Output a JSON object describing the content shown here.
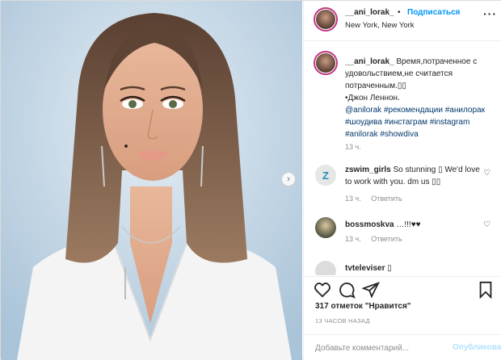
{
  "header": {
    "username": "__ani_lorak_",
    "dot": "•",
    "follow_label": "Подписаться",
    "location": "New York, New York",
    "more_icon": "more-horizontal-icon"
  },
  "caption": {
    "username": "__ani_lorak_",
    "text_line1": "Время,потраченное с удовольствием,не считается потраченным.",
    "emoji": "▯▯",
    "author": "•Джон Леннон.",
    "mention": "@anilorak",
    "hashtags": [
      "#рекомендации",
      "#анилорак",
      "#шоудива",
      "#инстаграм",
      "#instagram",
      "#anilorak",
      "#showdiva"
    ],
    "time": "13 ч."
  },
  "comments": [
    {
      "username": "zswim_girls",
      "text": "So stunning ▯ We'd love to work with you. dm us ▯▯",
      "time": "13 ч.",
      "reply": "Ответить",
      "avatar_letter": "Z"
    },
    {
      "username": "bossmoskva",
      "text": "…!!!♥♥",
      "time": "13 ч.",
      "reply": "Ответить"
    },
    {
      "username": "tvteleviser",
      "text": "▯"
    }
  ],
  "actions": {
    "like_icon": "heart-icon",
    "comment_icon": "comment-icon",
    "share_icon": "share-icon",
    "save_icon": "bookmark-icon"
  },
  "likes": "317 отметок \"Нравится\"",
  "posted": "13 ЧАСОВ НАЗАД",
  "add_comment": {
    "placeholder": "Добавьте комментарий...",
    "publish_label": "Опубликовать"
  },
  "colors": {
    "follow_blue": "#0095f6",
    "hashtag_blue": "#00376b",
    "publish_disabled": "#b2dffc",
    "muted": "#8e8e8e"
  }
}
